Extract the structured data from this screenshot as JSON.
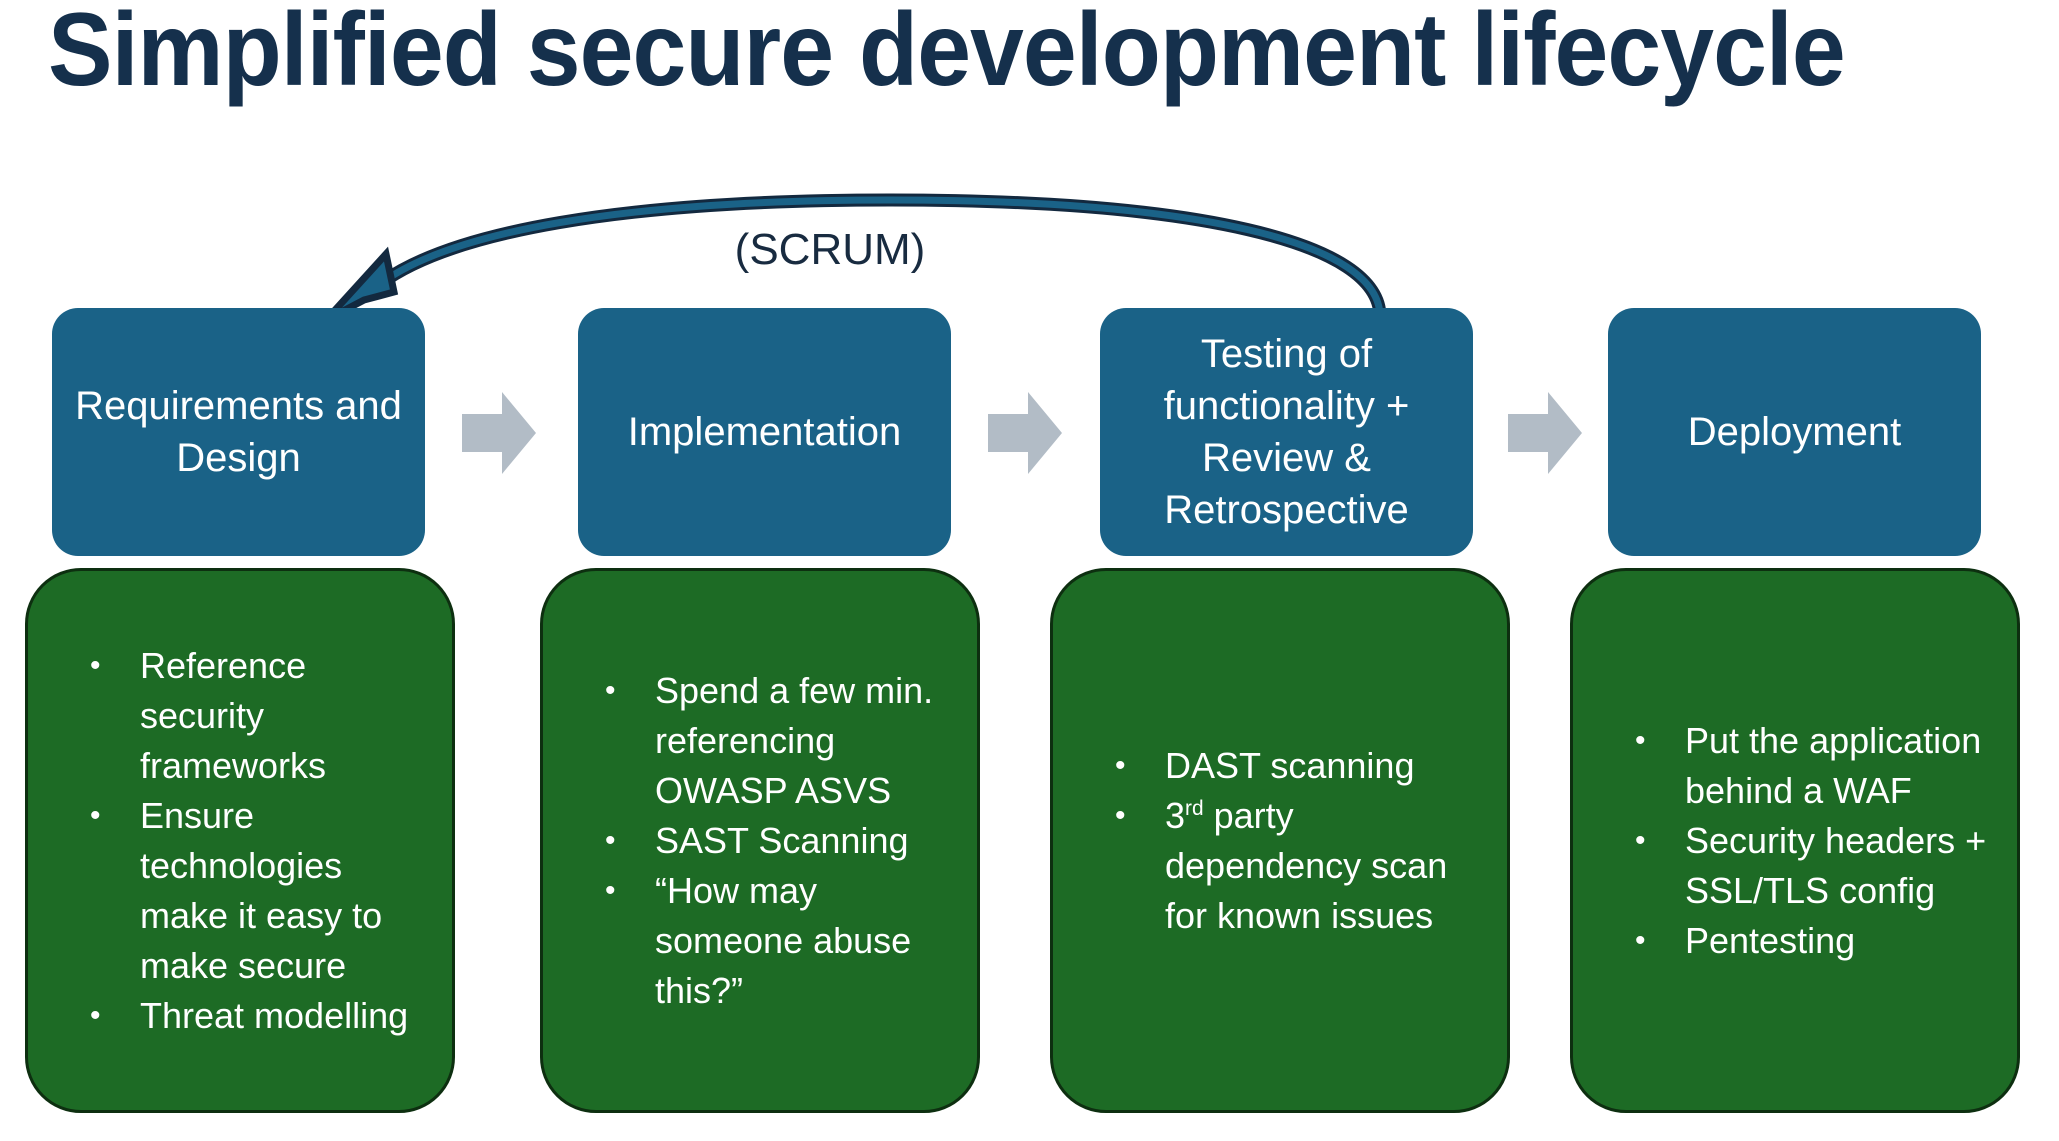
{
  "title": "Simplified secure development lifecycle",
  "loop": {
    "label": "(SCRUM)",
    "arrow_name": "scrum-loop-arrow"
  },
  "colors": {
    "title": "#15304c",
    "stage_box": "#1a6287",
    "detail_box": "#1d6b25",
    "detail_box_border": "#0d2f10",
    "connector_arrow": "#b2bcc6",
    "loop_arrow_fill": "#1a6287",
    "loop_arrow_stroke": "#13293f",
    "text_on_box": "#ffffff",
    "background": "#ffffff"
  },
  "stages": [
    {
      "label": "Requirements and Design"
    },
    {
      "label": "Implementation"
    },
    {
      "label": "Testing of functionality + Review & Retrospective"
    },
    {
      "label": "Deployment"
    }
  ],
  "details": [
    {
      "items": [
        {
          "text": "Reference security frameworks"
        },
        {
          "text": "Ensure technologies make it easy to make secure"
        },
        {
          "text": "Threat modelling"
        }
      ]
    },
    {
      "items": [
        {
          "text": "Spend a few min. referencing OWASP ASVS"
        },
        {
          "text": "SAST Scanning"
        },
        {
          "text": "“How may someone abuse this?”"
        }
      ]
    },
    {
      "items": [
        {
          "text": "DAST scanning"
        },
        {
          "text": "3",
          "sup": "rd",
          "text_after": " party dependency scan for known issues"
        }
      ]
    },
    {
      "items": [
        {
          "text": "Put the application behind a WAF"
        },
        {
          "text": "Security headers + SSL/TLS config"
        },
        {
          "text": "Pentesting"
        }
      ]
    }
  ],
  "connectors": [
    {
      "name": "connector-arrow-1"
    },
    {
      "name": "connector-arrow-2"
    },
    {
      "name": "connector-arrow-3"
    }
  ]
}
